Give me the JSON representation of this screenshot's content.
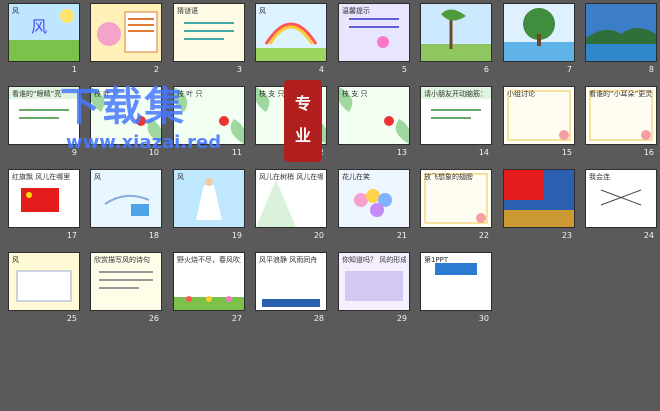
{
  "slides": [
    {
      "n": "1",
      "theme": "sky",
      "title": "风"
    },
    {
      "n": "2",
      "theme": "cartoon",
      "title": ""
    },
    {
      "n": "3",
      "theme": "paper",
      "title": "猜谜语"
    },
    {
      "n": "4",
      "theme": "rainbow",
      "title": "风"
    },
    {
      "n": "5",
      "theme": "lavender",
      "title": "温馨提示"
    },
    {
      "n": "6",
      "theme": "willow",
      "title": ""
    },
    {
      "n": "7",
      "theme": "tree",
      "title": ""
    },
    {
      "n": "8",
      "theme": "sea",
      "title": ""
    },
    {
      "n": "9",
      "theme": "green",
      "title": "看谁的“眼睛”亮"
    },
    {
      "n": "10",
      "theme": "leaf",
      "title": "枝 叶 只"
    },
    {
      "n": "11",
      "theme": "leaf",
      "title": "枝 叶 只"
    },
    {
      "n": "12",
      "theme": "leaf",
      "title": "枝 支 只"
    },
    {
      "n": "13",
      "theme": "leaf",
      "title": "枝 支 只"
    },
    {
      "n": "14",
      "theme": "green",
      "title": "请小朋友开动脑筋："
    },
    {
      "n": "15",
      "theme": "paper2",
      "title": "小组讨论"
    },
    {
      "n": "16",
      "theme": "paper2",
      "title": "看谁的“小耳朵”更灵"
    },
    {
      "n": "17",
      "theme": "flag",
      "title": "红旗飘 风儿在哪里"
    },
    {
      "n": "18",
      "theme": "bluekite",
      "title": "风"
    },
    {
      "n": "19",
      "theme": "dress",
      "title": "风"
    },
    {
      "n": "20",
      "theme": "white",
      "title": "风儿在树梢 风儿在哪里"
    },
    {
      "n": "21",
      "theme": "balloon",
      "title": "花儿在笑"
    },
    {
      "n": "22",
      "theme": "paper2",
      "title": "放飞想象的翅膀"
    },
    {
      "n": "23",
      "theme": "flagcity",
      "title": ""
    },
    {
      "n": "24",
      "theme": "white2",
      "title": "我会连"
    },
    {
      "n": "25",
      "theme": "yellow",
      "title": "风"
    },
    {
      "n": "26",
      "theme": "paper3",
      "title": "欣赏描写风的诗句"
    },
    {
      "n": "27",
      "theme": "flowers",
      "title": "野火烧不尽，春风吹又生。"
    },
    {
      "n": "28",
      "theme": "bluewords",
      "title": "风平浪静 风雨同舟"
    },
    {
      "n": "29",
      "theme": "purple",
      "title": "你知道吗？ 风的形成"
    },
    {
      "n": "30",
      "theme": "ppt",
      "title": "第1PPT"
    }
  ],
  "watermark": {
    "main": "下载集",
    "url": "www.xiazai.red",
    "seal": "专业"
  },
  "colors": {
    "bg": "#5a5a5a",
    "text": "#f2f2f2",
    "accent": "#4678ff",
    "seal": "#b21f1f"
  }
}
